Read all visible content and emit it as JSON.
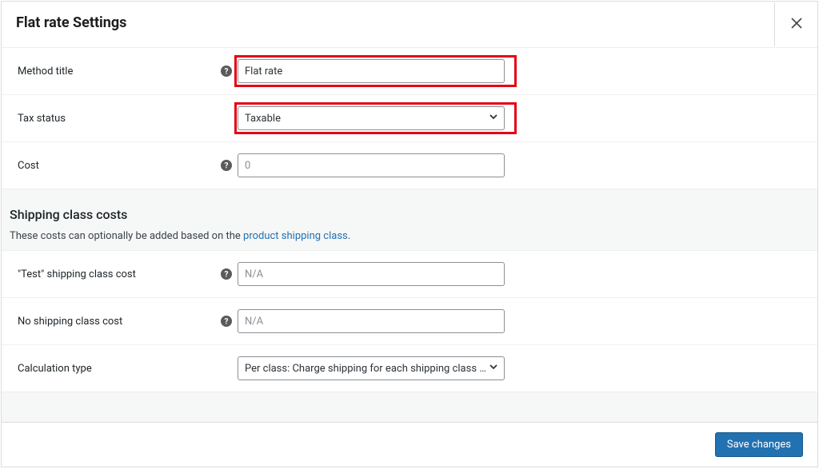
{
  "header": {
    "title": "Flat rate Settings"
  },
  "fields": {
    "method_title": {
      "label": "Method title",
      "value": "Flat rate"
    },
    "tax_status": {
      "label": "Tax status",
      "value": "Taxable"
    },
    "cost": {
      "label": "Cost",
      "placeholder": "0"
    },
    "test_class": {
      "label": "\"Test\" shipping class cost",
      "placeholder": "N/A"
    },
    "no_class": {
      "label": "No shipping class cost",
      "placeholder": "N/A"
    },
    "calc_type": {
      "label": "Calculation type",
      "value": "Per class: Charge shipping for each shipping class individually"
    }
  },
  "section": {
    "heading": "Shipping class costs",
    "desc_prefix": "These costs can optionally be added based on the ",
    "link_text": "product shipping class",
    "desc_suffix": "."
  },
  "footer": {
    "save": "Save changes"
  }
}
